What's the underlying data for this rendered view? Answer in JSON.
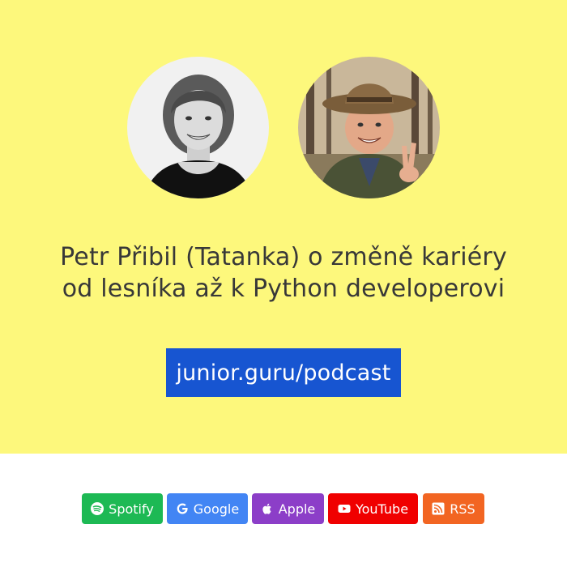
{
  "episode": {
    "title_line1": "Petr Přibil (Tatanka) o změně kariéry",
    "title_line2": "od lesníka až k Python developerovi"
  },
  "cta": {
    "label": "junior.guru/podcast"
  },
  "guests": [
    {
      "icon": "woman-portrait"
    },
    {
      "icon": "man-portrait-with-hat"
    }
  ],
  "platforms": [
    {
      "label": "Spotify",
      "icon": "spotify-icon",
      "color": "#1db954"
    },
    {
      "label": "Google",
      "icon": "google-icon",
      "color": "#4285f4"
    },
    {
      "label": "Apple",
      "icon": "apple-icon",
      "color": "#8c3ec8"
    },
    {
      "label": "YouTube",
      "icon": "youtube-icon",
      "color": "#f00000"
    },
    {
      "label": "RSS",
      "icon": "rss-icon",
      "color": "#f26522"
    }
  ],
  "colors": {
    "background": "#fdf87c",
    "cta": "#1755d1",
    "text": "#383838"
  }
}
